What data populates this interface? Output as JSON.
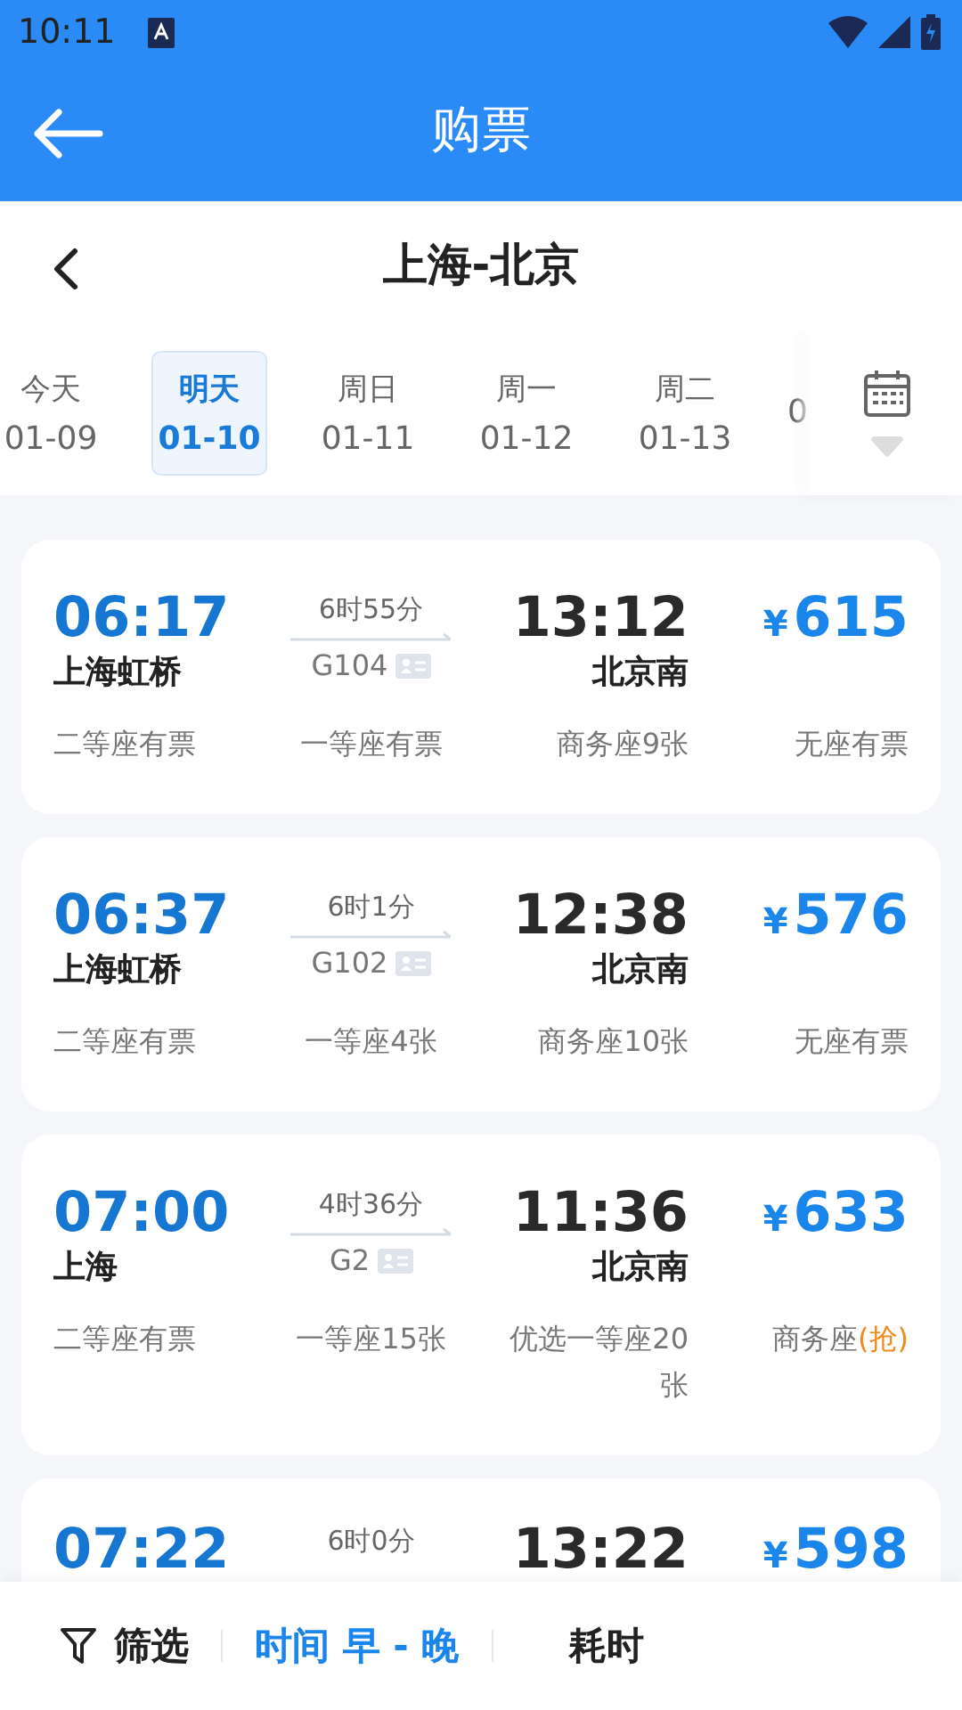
{
  "status_bar": {
    "time": "10:11"
  },
  "header": {
    "title": "购票"
  },
  "route": {
    "title": "上海-北京"
  },
  "dates": [
    {
      "day": "今天",
      "date": "01-09",
      "selected": false
    },
    {
      "day": "明天",
      "date": "01-10",
      "selected": true
    },
    {
      "day": "周日",
      "date": "01-11",
      "selected": false
    },
    {
      "day": "周一",
      "date": "01-12",
      "selected": false
    },
    {
      "day": "周二",
      "date": "01-13",
      "selected": false
    },
    {
      "date": "0",
      "selected": false
    }
  ],
  "trains": [
    {
      "depart": "06:17",
      "from": "上海虹桥",
      "duration": "6时55分",
      "number": "G104",
      "arrive": "13:12",
      "to": "北京南",
      "currency": "¥",
      "price": "615",
      "seats": [
        {
          "text": "二等座有票"
        },
        {
          "text": "一等座有票"
        },
        {
          "text": "商务座9张"
        },
        {
          "text": "无座有票"
        }
      ]
    },
    {
      "depart": "06:37",
      "from": "上海虹桥",
      "duration": "6时1分",
      "number": "G102",
      "arrive": "12:38",
      "to": "北京南",
      "currency": "¥",
      "price": "576",
      "seats": [
        {
          "text": "二等座有票"
        },
        {
          "text": "一等座4张"
        },
        {
          "text": "商务座10张"
        },
        {
          "text": "无座有票"
        }
      ]
    },
    {
      "depart": "07:00",
      "from": "上海",
      "duration": "4时36分",
      "number": "G2",
      "arrive": "11:36",
      "to": "北京南",
      "currency": "¥",
      "price": "633",
      "seats": [
        {
          "text": "二等座有票"
        },
        {
          "text": "一等座15张"
        },
        {
          "text": "优选一等座20张"
        },
        {
          "text": "商务座",
          "extra": "(抢)"
        }
      ]
    },
    {
      "depart": "07:22",
      "duration": "6时0分",
      "arrive": "13:22",
      "currency": "¥",
      "price": "598"
    }
  ],
  "sort_bar": [
    {
      "kind": "filter",
      "label": "筛选",
      "selected": false
    },
    {
      "kind": "sort",
      "label": "时间 早 - 晚",
      "selected": true
    },
    {
      "kind": "sort",
      "label": "耗时",
      "selected": false
    }
  ]
}
